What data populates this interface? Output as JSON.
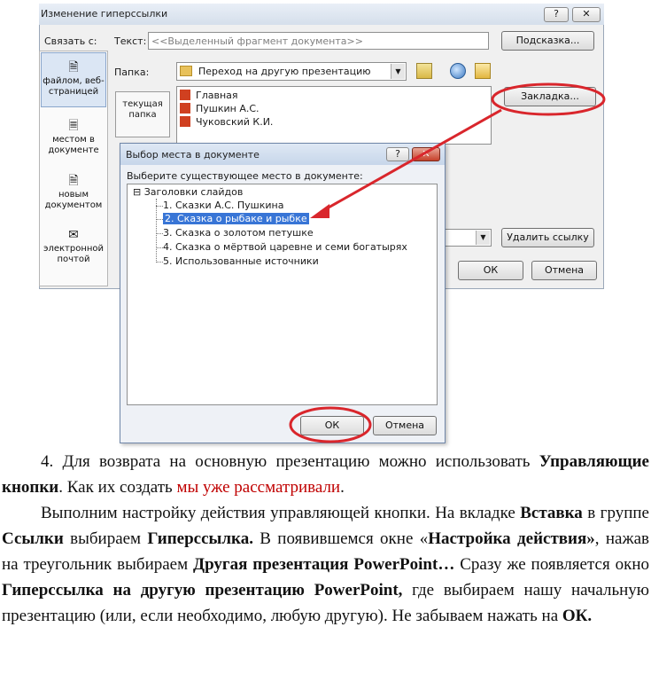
{
  "hyperlink_dialog": {
    "title": "Изменение гиперссылки",
    "help_glyph": "?",
    "close_glyph": "✕",
    "link_to_label": "Связать с:",
    "text_label": "Текст:",
    "text_value": "<<Выделенный фрагмент документа>>",
    "tooltip_button": "Подсказка...",
    "folder_label": "Папка:",
    "folder_value": "Переход на другую презентацию",
    "bookmark_button": "Закладка...",
    "current_folder_tab": "текущая папка",
    "files": [
      "Главная",
      "Пушкин А.С.",
      "Чуковский К.И."
    ],
    "nav": [
      {
        "label": "файлом, веб-страницей",
        "icon": "file-web-icon"
      },
      {
        "label": "местом в документе",
        "icon": "place-in-document-icon"
      },
      {
        "label": "новым документом",
        "icon": "new-document-icon"
      },
      {
        "label": "электронной почтой",
        "icon": "email-icon"
      }
    ],
    "remove_link_button": "Удалить ссылку",
    "ok_button": "ОК",
    "cancel_button": "Отмена"
  },
  "place_dialog": {
    "title": "Выбор места в документе",
    "help_glyph": "?",
    "close_glyph": "✕",
    "prompt": "Выберите существующее место в документе:",
    "tree_root": "Заголовки слайдов",
    "tree_toggle": "⊟",
    "items": [
      "1. Сказки  А.С. Пушкина",
      "2. Сказка о рыбаке и рыбке",
      "3. Сказка о золотом петушке",
      "4. Сказка о мёртвой царевне и семи богатырях",
      "5. Использованные источники"
    ],
    "selected_index": 1,
    "ok_button": "ОК",
    "cancel_button": "Отмена"
  },
  "annotation_color": "#d9262c",
  "text": {
    "p1_part1": "4. Для возврата на основную презентацию можно использовать ",
    "p1_bold": "Управляющие кнопки",
    "p1_part2": ". Как их создать ",
    "p1_red": "мы уже рассматривали",
    "p1_end": ".",
    "p2_1": "Выполним настройку действия управляющей кнопки. На вкладке ",
    "p2_b1": "Вставка",
    "p2_2": "  в группе ",
    "p2_b2": "Ссылки",
    "p2_3": " выбираем ",
    "p2_b3": "Гиперссылка.",
    "p2_4": " В появившемся окне «",
    "p2_b4": "Настройка действия»",
    "p2_5": ", нажав на треугольник выбираем ",
    "p2_b5": "Другая презентация PowerPoint…",
    "p2_6": "  Сразу же появляется окно ",
    "p2_b6": "Гиперссылка на другую презентацию",
    "p2_7": "  ",
    "p2_b7": "PowerPoint,",
    "p2_8": " где выбираем нашу начальную презентацию (или, если необходимо, любую другую). Не забываем нажать на ",
    "p2_b8": "ОК."
  }
}
